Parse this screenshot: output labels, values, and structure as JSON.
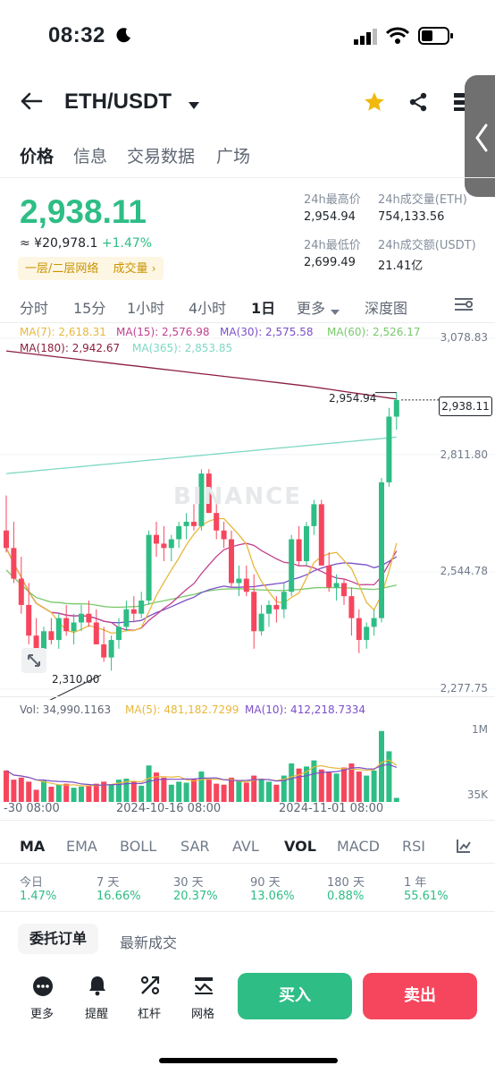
{
  "status": {
    "time": "08:32"
  },
  "header": {
    "pair": "ETH/USDT"
  },
  "tabs": [
    "价格",
    "信息",
    "交易数据",
    "广场"
  ],
  "price": {
    "last": "2,938.11",
    "fiat": "≈ ¥20,978.1",
    "change": "+1.47%",
    "tag_grid": "一层/二层网络",
    "tag_volume": "成交量"
  },
  "stats": {
    "high_label": "24h最高价",
    "high": "2,954.94",
    "vol_eth_label": "24h成交量(ETH)",
    "vol_eth": "754,133.56",
    "low_label": "24h最低价",
    "low": "2,699.49",
    "vol_usdt_label": "24h成交额(USDT)",
    "vol_usdt": "21.41亿"
  },
  "timeframes": [
    "分时",
    "15分",
    "1小时",
    "4小时",
    "1日",
    "更多",
    "深度图"
  ],
  "ma_legend": {
    "ma7": "MA(7): 2,618.31",
    "ma15": "MA(15): 2,576.98",
    "ma30": "MA(30): 2,575.58",
    "ma60": "MA(60): 2,526.17",
    "ma180": "MA(180): 2,942.67",
    "ma365": "MA(365): 2,853.85"
  },
  "colors": {
    "up": "#2ebd85",
    "down": "#f6465d",
    "ma7": "#e8b73b",
    "ma15": "#c2408f",
    "ma30": "#7b4fc9",
    "ma60": "#78c96a",
    "ma180": "#8b1e3f",
    "ma365": "#7fd8c3"
  },
  "chart_data": {
    "type": "candlestick",
    "y_axis_ticks": [
      "3,078.83",
      "2,811.80",
      "2,544.78",
      "2,277.75"
    ],
    "last_price_label": "2,938.11",
    "high_marker": "2,954.94",
    "low_marker": "2,310.00",
    "x_labels": [
      "-30 08:00",
      "2024-10-16 08:00",
      "2024-11-01 08:00"
    ],
    "watermark": "BINANCE",
    "candles": [
      [
        2640,
        2720,
        2590,
        2600
      ],
      [
        2600,
        2660,
        2520,
        2530
      ],
      [
        2530,
        2580,
        2450,
        2470
      ],
      [
        2470,
        2520,
        2380,
        2400
      ],
      [
        2400,
        2440,
        2350,
        2370
      ],
      [
        2370,
        2420,
        2340,
        2410
      ],
      [
        2410,
        2440,
        2380,
        2390
      ],
      [
        2390,
        2450,
        2370,
        2440
      ],
      [
        2440,
        2470,
        2400,
        2410
      ],
      [
        2410,
        2450,
        2380,
        2430
      ],
      [
        2430,
        2470,
        2410,
        2450
      ],
      [
        2450,
        2480,
        2420,
        2430
      ],
      [
        2430,
        2460,
        2380,
        2380
      ],
      [
        2380,
        2420,
        2340,
        2350
      ],
      [
        2350,
        2400,
        2320,
        2390
      ],
      [
        2390,
        2440,
        2370,
        2420
      ],
      [
        2420,
        2480,
        2410,
        2460
      ],
      [
        2460,
        2490,
        2430,
        2450
      ],
      [
        2450,
        2500,
        2440,
        2480
      ],
      [
        2480,
        2640,
        2470,
        2630
      ],
      [
        2630,
        2660,
        2580,
        2610
      ],
      [
        2610,
        2650,
        2570,
        2600
      ],
      [
        2600,
        2630,
        2570,
        2620
      ],
      [
        2620,
        2660,
        2600,
        2650
      ],
      [
        2650,
        2680,
        2620,
        2660
      ],
      [
        2660,
        2700,
        2640,
        2650
      ],
      [
        2650,
        2780,
        2640,
        2770
      ],
      [
        2770,
        2780,
        2680,
        2680
      ],
      [
        2680,
        2700,
        2620,
        2640
      ],
      [
        2640,
        2660,
        2600,
        2620
      ],
      [
        2620,
        2640,
        2510,
        2520
      ],
      [
        2520,
        2560,
        2490,
        2530
      ],
      [
        2530,
        2560,
        2490,
        2500
      ],
      [
        2500,
        2540,
        2370,
        2410
      ],
      [
        2410,
        2470,
        2400,
        2450
      ],
      [
        2450,
        2480,
        2420,
        2470
      ],
      [
        2470,
        2490,
        2430,
        2460
      ],
      [
        2460,
        2520,
        2440,
        2500
      ],
      [
        2500,
        2630,
        2490,
        2620
      ],
      [
        2620,
        2650,
        2560,
        2570
      ],
      [
        2570,
        2660,
        2560,
        2650
      ],
      [
        2650,
        2710,
        2630,
        2700
      ],
      [
        2700,
        2710,
        2560,
        2560
      ],
      [
        2560,
        2590,
        2500,
        2510
      ],
      [
        2510,
        2540,
        2480,
        2520
      ],
      [
        2520,
        2530,
        2470,
        2490
      ],
      [
        2490,
        2510,
        2400,
        2440
      ],
      [
        2440,
        2460,
        2360,
        2390
      ],
      [
        2390,
        2430,
        2370,
        2420
      ],
      [
        2420,
        2460,
        2400,
        2440
      ],
      [
        2440,
        2760,
        2430,
        2750
      ],
      [
        2750,
        2920,
        2740,
        2900
      ],
      [
        2900,
        2955,
        2870,
        2938
      ]
    ]
  },
  "volume": {
    "vol": "Vol: 34,990.1163",
    "ma5": "MA(5): 481,182.7299",
    "ma10": "MA(10): 412,218.7334",
    "axis_top": "1M",
    "axis_bottom": "35K",
    "bars": [
      310,
      220,
      240,
      200,
      120,
      210,
      150,
      170,
      180,
      140,
      150,
      160,
      180,
      200,
      170,
      220,
      230,
      200,
      160,
      360,
      290,
      240,
      170,
      200,
      190,
      230,
      300,
      220,
      180,
      170,
      240,
      210,
      190,
      260,
      230,
      200,
      170,
      260,
      380,
      330,
      350,
      410,
      320,
      300,
      280,
      340,
      380,
      300,
      260,
      310,
      700,
      500,
      40
    ]
  },
  "indicator_tabs": [
    "MA",
    "EMA",
    "BOLL",
    "SAR",
    "AVL",
    "VOL",
    "MACD",
    "RSI"
  ],
  "performance": [
    {
      "label": "今日",
      "value": "1.47%"
    },
    {
      "label": "7 天",
      "value": "16.66%"
    },
    {
      "label": "30 天",
      "value": "20.37%"
    },
    {
      "label": "90 天",
      "value": "13.06%"
    },
    {
      "label": "180 天",
      "value": "0.88%"
    },
    {
      "label": "1 年",
      "value": "55.61%"
    }
  ],
  "order_tabs": [
    "委托订单",
    "最新成交"
  ],
  "bottom_bar": {
    "more": "更多",
    "alert": "提醒",
    "leverage": "杠杆",
    "grid": "网格",
    "buy": "买入",
    "sell": "卖出"
  }
}
